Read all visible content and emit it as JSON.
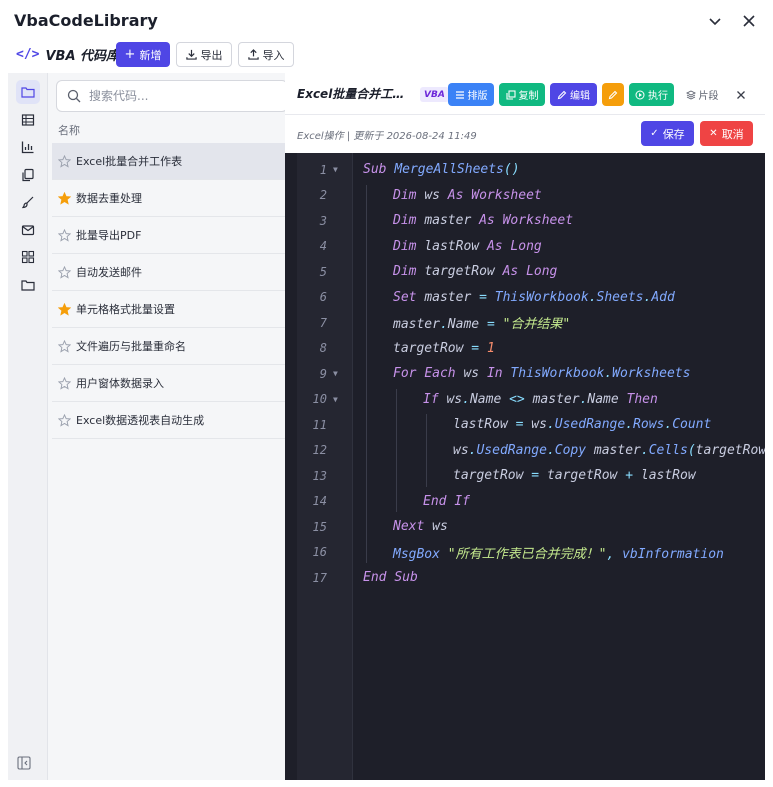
{
  "window": {
    "title": "VbaCodeLibrary"
  },
  "toolbar": {
    "logo_icon": "</>",
    "logo_text": "VBA 代码库",
    "new_label": "新增",
    "export_label": "导出",
    "import_label": "导入"
  },
  "rail": {
    "items": [
      "folder-icon",
      "table-icon",
      "chart-icon",
      "copy-icon",
      "brush-icon",
      "mail-icon",
      "grid-icon",
      "folder-outline-icon"
    ]
  },
  "list": {
    "search_placeholder": "搜索代码...",
    "column_header": "名称",
    "items": [
      {
        "label": "Excel批量合并工作表",
        "starred": false
      },
      {
        "label": "数据去重处理",
        "starred": true
      },
      {
        "label": "批量导出PDF",
        "starred": false
      },
      {
        "label": "自动发送邮件",
        "starred": false
      },
      {
        "label": "单元格格式批量设置",
        "starred": true
      },
      {
        "label": "文件遍历与批量重命名",
        "starred": false
      },
      {
        "label": "用户窗体数据录入",
        "starred": false
      },
      {
        "label": "Excel数据透视表自动生成",
        "starred": false
      }
    ]
  },
  "detail": {
    "title": "Excel批量合并工…",
    "lang": "VBA",
    "format_label": "排版",
    "copy_label": "复制",
    "edit_label": "编辑",
    "run_label": "执行",
    "snippet_label": "片段",
    "meta": "Excel操作 | 更新于 2026-08-24 11:49",
    "save_label": "保存",
    "cancel_label": "取消"
  },
  "colors": {
    "accent": "#4f46e5",
    "green": "#10b981",
    "blue": "#3b82f6",
    "orange": "#f59e0b",
    "red": "#ef4444",
    "editor_bg": "#1e1f29"
  },
  "code": [
    "Sub MergeAllSheets()",
    "Dim ws As Worksheet",
    "Dim master As Worksheet",
    "Dim lastRow As Long",
    "Dim targetRow As Long",
    "Set master = ThisWorkbook.Sheets.Add",
    "master.Name = \"合并结果\"",
    "targetRow = 1",
    "For Each ws In ThisWorkbook.Worksheets",
    "If ws.Name <> master.Name Then",
    "lastRow = ws.UsedRange.Rows.Count",
    "ws.UsedRange.Copy master.Cells(targetRow,",
    "targetRow = targetRow + lastRow",
    "End If",
    "Next ws",
    "MsgBox \"所有工作表已合并完成！\", vbInformation",
    "End Sub"
  ]
}
